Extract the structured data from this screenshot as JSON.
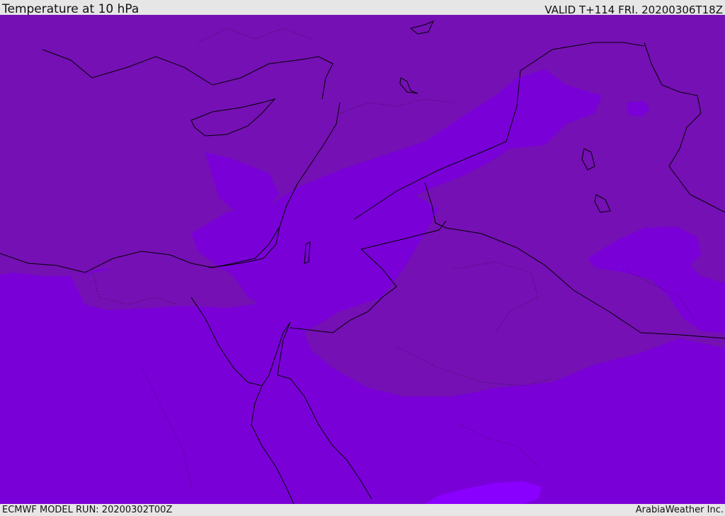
{
  "header": {
    "title": "Temperature at 10 hPa",
    "valid": "VALID T+114 FRI. 20200306T18Z"
  },
  "footer": {
    "model_run": "ECMWF MODEL RUN: 20200302T00Z",
    "brand": "ArabiaWeather Inc."
  },
  "map": {
    "field": "temperature",
    "level": "10 hPa",
    "colors": {
      "band_dark": "#7510b4",
      "band_mid": "#7a00d8",
      "band_light": "#8400f2",
      "band_lightest": "#8a00ff",
      "coastline": "#000000"
    }
  }
}
